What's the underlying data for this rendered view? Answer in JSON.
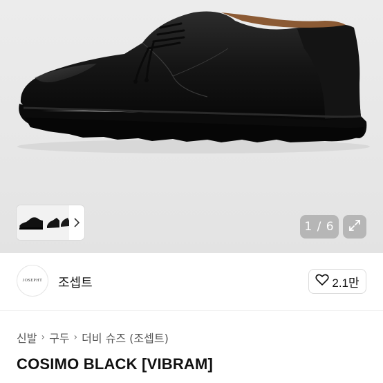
{
  "gallery": {
    "counter": "1 / 6",
    "thumbnail_next_icon": "chevron-right-icon",
    "expand_icon": "expand-icon"
  },
  "shop": {
    "logo_text": "JOSEPHT",
    "logo_subtext": "",
    "name": "조셉트",
    "like_icon": "heart-outline-icon",
    "like_count": "2.1만"
  },
  "breadcrumb": {
    "items": [
      "신발",
      "구두",
      "더비 슈즈 (조셉트)"
    ],
    "separator_icon": "chevron-right-icon"
  },
  "product": {
    "title": "COSIMO BLACK [VIBRAM]"
  },
  "colors": {
    "hero_background": "#e8e8e8",
    "overlay_button": "#8a8a8a",
    "text_primary": "#111111",
    "text_secondary": "#555555"
  }
}
